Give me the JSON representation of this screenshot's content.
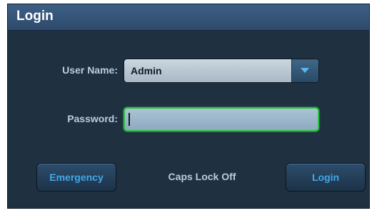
{
  "dialog": {
    "title": "Login"
  },
  "form": {
    "user_name_label": "User Name:",
    "user_name_value": "Admin",
    "password_label": "Password:",
    "password_value": ""
  },
  "footer": {
    "emergency_label": "Emergency",
    "caps_lock_status": "Caps Lock Off",
    "login_label": "Login"
  },
  "colors": {
    "background": "#1f3040",
    "title_bar": "#34567a",
    "focus_border": "#2ec240",
    "button_text": "#41a8ea"
  }
}
